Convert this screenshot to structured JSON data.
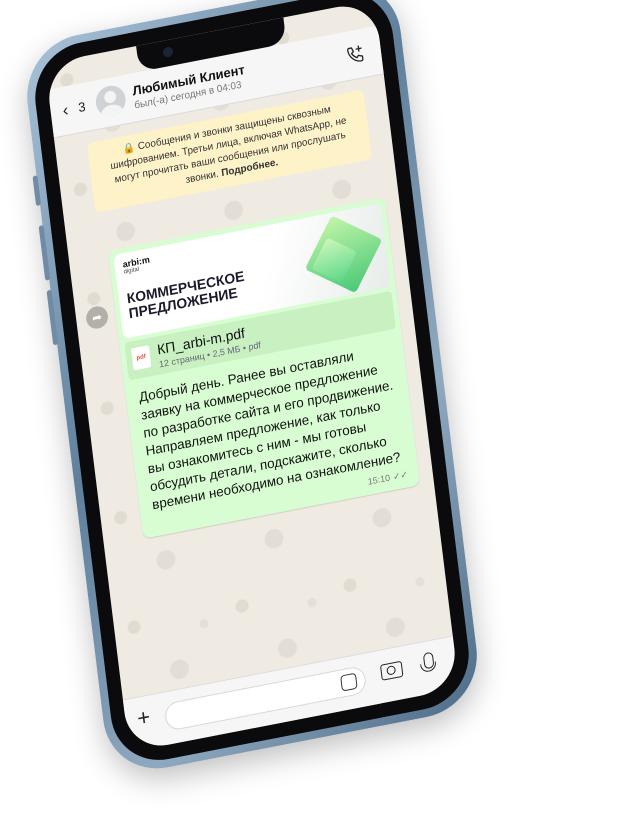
{
  "header": {
    "back_count": "3",
    "contact_name": "Любимый Клиент",
    "contact_status": "был(-а) сегодня в 04:03"
  },
  "notice": {
    "lock_icon": "lock-icon",
    "text": "Сообщения и звонки защищены сквозным шифрованием. Третьи лица, включая WhatsApp, не могут прочитать ваши сообщения или прослушать звонки.",
    "more": "Подробнее."
  },
  "message": {
    "brand": "arbi:m",
    "brand_sub": "digital",
    "doc_headline": "КОММЕРЧЕСКОЕ ПРЕДЛОЖЕНИЕ",
    "file_type_badge": "pdf",
    "file_name": "КП_arbi-m.pdf",
    "file_meta": "12 страниц • 2,5 МБ • pdf",
    "text": "Добрый день. Ранее вы оставляли заявку на коммерческое предложение по разработке сайта и его продвижение. Направляем предложение, как только вы ознакомитесь с ним - мы готовы обсудить детали, подскажите, сколько времени необходимо на ознакомление?",
    "time": "15:10",
    "ticks": "✓✓"
  },
  "input_bar": {
    "plus": "+"
  },
  "colors": {
    "bubble": "#d9fdd3",
    "notice": "#fdf2c8",
    "frame": "#5f7f9b"
  }
}
